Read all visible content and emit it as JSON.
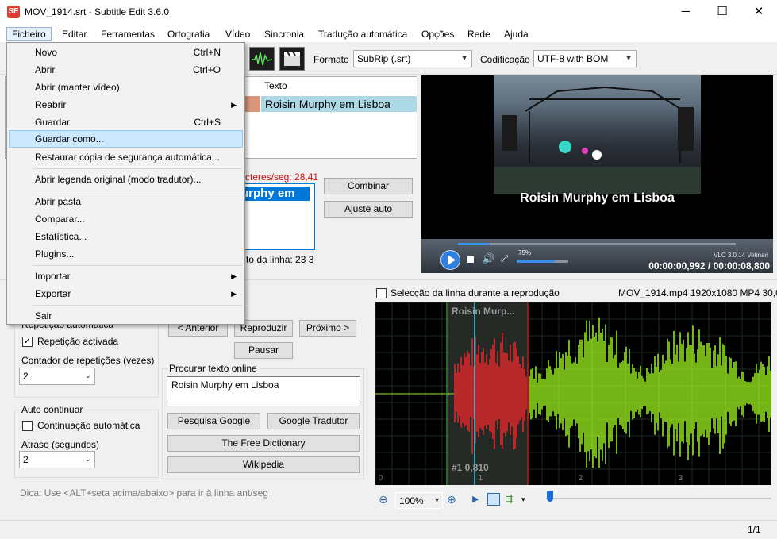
{
  "window": {
    "title": "MOV_1914.srt - Subtitle Edit 3.6.0",
    "icon": "SE",
    "controls": {
      "minimize": "─",
      "maximize": "☐",
      "close": "✕"
    }
  },
  "menu": {
    "items": [
      "Ficheiro",
      "Editar",
      "Ferramentas",
      "Ortografia",
      "Vídeo",
      "Sincronia",
      "Tradução automática",
      "Opções",
      "Rede",
      "Ajuda"
    ]
  },
  "toolbar": {
    "format_label": "Formato",
    "format_value": "SubRip (.srt)",
    "encoding_label": "Codificação",
    "encoding_value": "UTF-8 with BOM"
  },
  "grid": {
    "header_text": "Texto",
    "row_text": "Roisin Murphy em Lisboa"
  },
  "editor": {
    "chars_per_sec": "cteres/seg: 28,41",
    "text_value": "urphy em",
    "line_length": "to da linha: 23 3",
    "combine_button": "Combinar",
    "auto_adjust_button": "Ajuste auto"
  },
  "video": {
    "subtitle_overlay": "Roisin Murphy em Lisboa",
    "volume": "75%",
    "vlc_label": "VLC 3.0.14 Vetinari",
    "time": "00:00:00,992 / 00:00:08,800"
  },
  "playback": {
    "repeat_group": "Repetição automática",
    "repeat_checkbox": "Repetição activada",
    "repeat_count_label": "Contador de repetições (vezes)",
    "repeat_count_value": "2",
    "continue_group": "Auto continuar",
    "continue_checkbox": "Continuação automática",
    "delay_label": "Atraso (segundos)",
    "delay_value": "2",
    "prev_button": "< Anterior",
    "play_button": "Reproduzir",
    "next_button": "Próximo >",
    "pause_button": "Pausar",
    "search_group": "Procurar texto online",
    "search_text": "Roisin Murphy em Lisboa",
    "google_search_button": "Pesquisa Google",
    "google_translate_button": "Google Tradutor",
    "free_dictionary_button": "The Free Dictionary",
    "wikipedia_button": "Wikipedia",
    "tip": "Dica: Use <ALT+seta acima/abaixo> para ir à linha ant/seg"
  },
  "waveform": {
    "select_checkbox": "Selecção da linha durante a reprodução",
    "media_info": "MOV_1914.mp4 1920x1080 MP4 30,0",
    "sub_label": "Roisin Murp...",
    "line_info": "#1  0,810",
    "ticks": [
      "0",
      "1",
      "2",
      "3"
    ],
    "zoom": "100%",
    "selection_color": "#e8262a",
    "wave_color": "#9cf01e"
  },
  "status": {
    "page": "1/1"
  },
  "file_menu": {
    "items": [
      {
        "label": "Novo",
        "shortcut": "Ctrl+N",
        "submenu": false
      },
      {
        "label": "Abrir",
        "shortcut": "Ctrl+O",
        "submenu": false
      },
      {
        "label": "Abrir (manter vídeo)",
        "shortcut": "",
        "submenu": false
      },
      {
        "label": "Reabrir",
        "shortcut": "",
        "submenu": true
      },
      {
        "label": "Guardar",
        "shortcut": "Ctrl+S",
        "submenu": false
      },
      {
        "label": "Guardar como...",
        "shortcut": "",
        "submenu": false
      },
      {
        "label": "Restaurar cópia de segurança automática...",
        "shortcut": "",
        "submenu": false
      },
      {
        "label": "Abrir legenda original (modo tradutor)...",
        "shortcut": "",
        "submenu": false
      },
      {
        "label": "Abrir pasta",
        "shortcut": "",
        "submenu": false
      },
      {
        "label": "Comparar...",
        "shortcut": "",
        "submenu": false
      },
      {
        "label": "Estatística...",
        "shortcut": "",
        "submenu": false
      },
      {
        "label": "Plugins...",
        "shortcut": "",
        "submenu": false
      },
      {
        "label": "Importar",
        "shortcut": "",
        "submenu": true
      },
      {
        "label": "Exportar",
        "shortcut": "",
        "submenu": true
      },
      {
        "label": "Sair",
        "shortcut": "",
        "submenu": false
      }
    ]
  }
}
